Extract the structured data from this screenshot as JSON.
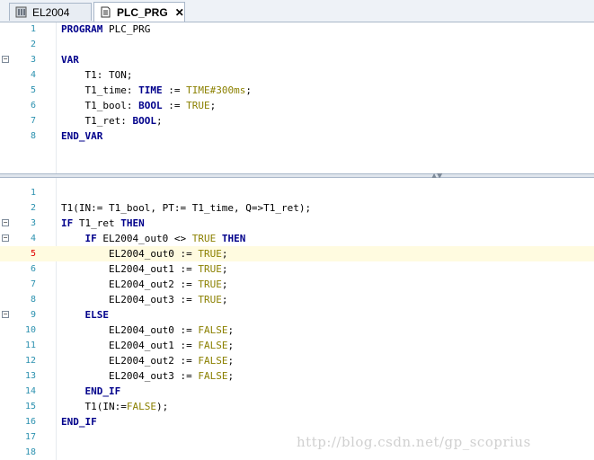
{
  "tabs": [
    {
      "label": "EL2004",
      "active": false,
      "icon": "device-icon"
    },
    {
      "label": "PLC_PRG",
      "active": true,
      "icon": "document-icon",
      "close": "✕"
    }
  ],
  "decl": {
    "lines": [
      {
        "n": "1",
        "tokens": [
          {
            "t": "PROGRAM",
            "c": "kw"
          },
          {
            "t": " PLC_PRG",
            "c": ""
          }
        ]
      },
      {
        "n": "2",
        "tokens": []
      },
      {
        "n": "3",
        "fold": true,
        "tokens": [
          {
            "t": "VAR",
            "c": "kw"
          }
        ]
      },
      {
        "n": "4",
        "tokens": [
          {
            "t": "    T1: TON;",
            "c": ""
          }
        ]
      },
      {
        "n": "5",
        "tokens": [
          {
            "t": "    T1_time: ",
            "c": ""
          },
          {
            "t": "TIME",
            "c": "ty"
          },
          {
            "t": " := ",
            "c": ""
          },
          {
            "t": "TIME#300ms",
            "c": "lit"
          },
          {
            "t": ";",
            "c": ""
          }
        ]
      },
      {
        "n": "6",
        "tokens": [
          {
            "t": "    T1_bool: ",
            "c": ""
          },
          {
            "t": "BOOL",
            "c": "ty"
          },
          {
            "t": " := ",
            "c": ""
          },
          {
            "t": "TRUE",
            "c": "lit"
          },
          {
            "t": ";",
            "c": ""
          }
        ]
      },
      {
        "n": "7",
        "tokens": [
          {
            "t": "    T1_ret: ",
            "c": ""
          },
          {
            "t": "BOOL",
            "c": "ty"
          },
          {
            "t": ";",
            "c": ""
          }
        ]
      },
      {
        "n": "8",
        "tokens": [
          {
            "t": "END_VAR",
            "c": "kw"
          }
        ]
      }
    ]
  },
  "impl": {
    "highlight_line": "5",
    "lines": [
      {
        "n": "1",
        "tokens": []
      },
      {
        "n": "2",
        "tokens": [
          {
            "t": "T1(IN:= T1_bool, PT:= T1_time, Q=>T1_ret);",
            "c": ""
          }
        ]
      },
      {
        "n": "3",
        "fold": true,
        "tokens": [
          {
            "t": "IF",
            "c": "kw"
          },
          {
            "t": " T1_ret ",
            "c": ""
          },
          {
            "t": "THEN",
            "c": "kw"
          }
        ]
      },
      {
        "n": "4",
        "fold": true,
        "tokens": [
          {
            "t": "    ",
            "c": ""
          },
          {
            "t": "IF",
            "c": "kw"
          },
          {
            "t": " EL2004_out0 <> ",
            "c": ""
          },
          {
            "t": "TRUE",
            "c": "lit"
          },
          {
            "t": " ",
            "c": ""
          },
          {
            "t": "THEN",
            "c": "kw"
          }
        ]
      },
      {
        "n": "5",
        "red": true,
        "tokens": [
          {
            "t": "        EL2004_out0 := ",
            "c": ""
          },
          {
            "t": "TRUE",
            "c": "lit"
          },
          {
            "t": ";",
            "c": ""
          }
        ]
      },
      {
        "n": "6",
        "tokens": [
          {
            "t": "        EL2004_out1 := ",
            "c": ""
          },
          {
            "t": "TRUE",
            "c": "lit"
          },
          {
            "t": ";",
            "c": ""
          }
        ]
      },
      {
        "n": "7",
        "tokens": [
          {
            "t": "        EL2004_out2 := ",
            "c": ""
          },
          {
            "t": "TRUE",
            "c": "lit"
          },
          {
            "t": ";",
            "c": ""
          }
        ]
      },
      {
        "n": "8",
        "tokens": [
          {
            "t": "        EL2004_out3 := ",
            "c": ""
          },
          {
            "t": "TRUE",
            "c": "lit"
          },
          {
            "t": ";",
            "c": ""
          }
        ]
      },
      {
        "n": "9",
        "fold": true,
        "tokens": [
          {
            "t": "    ",
            "c": ""
          },
          {
            "t": "ELSE",
            "c": "kw"
          }
        ]
      },
      {
        "n": "10",
        "tokens": [
          {
            "t": "        EL2004_out0 := ",
            "c": ""
          },
          {
            "t": "FALSE",
            "c": "lit"
          },
          {
            "t": ";",
            "c": ""
          }
        ]
      },
      {
        "n": "11",
        "tokens": [
          {
            "t": "        EL2004_out1 := ",
            "c": ""
          },
          {
            "t": "FALSE",
            "c": "lit"
          },
          {
            "t": ";",
            "c": ""
          }
        ]
      },
      {
        "n": "12",
        "tokens": [
          {
            "t": "        EL2004_out2 := ",
            "c": ""
          },
          {
            "t": "FALSE",
            "c": "lit"
          },
          {
            "t": ";",
            "c": ""
          }
        ]
      },
      {
        "n": "13",
        "tokens": [
          {
            "t": "        EL2004_out3 := ",
            "c": ""
          },
          {
            "t": "FALSE",
            "c": "lit"
          },
          {
            "t": ";",
            "c": ""
          }
        ]
      },
      {
        "n": "14",
        "tokens": [
          {
            "t": "    ",
            "c": ""
          },
          {
            "t": "END_IF",
            "c": "kw"
          }
        ]
      },
      {
        "n": "15",
        "tokens": [
          {
            "t": "    T1(IN:=",
            "c": ""
          },
          {
            "t": "FALSE",
            "c": "lit"
          },
          {
            "t": ");",
            "c": ""
          }
        ]
      },
      {
        "n": "16",
        "tokens": [
          {
            "t": "END_IF",
            "c": "kw"
          }
        ]
      },
      {
        "n": "17",
        "tokens": []
      },
      {
        "n": "18",
        "tokens": []
      }
    ]
  },
  "watermark": "http://blog.csdn.net/gp_scoprius"
}
